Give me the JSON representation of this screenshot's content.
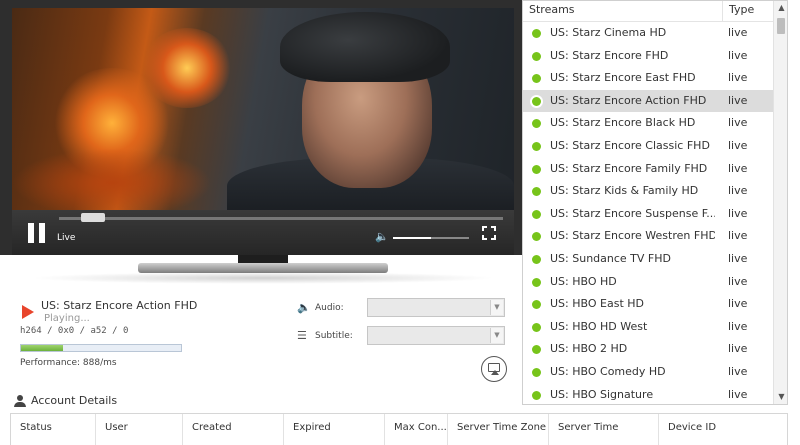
{
  "player": {
    "live_label": "Live",
    "seek_progress": 0.05,
    "volume_level": 0.5
  },
  "now_playing": {
    "title": "US: Starz Encore Action FHD",
    "status": "Playing...",
    "codec": "h264 / 0x0 / a52  / 0",
    "performance_label": "Performance:   888/ms",
    "performance_level": 0.26
  },
  "options": {
    "audio_label": "Audio:",
    "subtitle_label": "Subtitle:",
    "audio_value": "",
    "subtitle_value": ""
  },
  "streams": {
    "header_name": "Streams",
    "header_type": "Type",
    "items": [
      {
        "name": "US: Starz Cinema HD",
        "type": "live"
      },
      {
        "name": "US: Starz Encore FHD",
        "type": "live"
      },
      {
        "name": "US: Starz Encore East FHD",
        "type": "live"
      },
      {
        "name": "US: Starz Encore Action FHD",
        "type": "live"
      },
      {
        "name": "US: Starz Encore Black HD",
        "type": "live"
      },
      {
        "name": "US: Starz Encore Classic FHD",
        "type": "live"
      },
      {
        "name": "US: Starz Encore Family FHD",
        "type": "live"
      },
      {
        "name": "US: Starz Kids & Family HD",
        "type": "live"
      },
      {
        "name": "US: Starz Encore Suspense F...",
        "type": "live"
      },
      {
        "name": "US: Starz Encore Westren FHD",
        "type": "live"
      },
      {
        "name": "US: Sundance TV FHD",
        "type": "live"
      },
      {
        "name": "US: HBO HD",
        "type": "live"
      },
      {
        "name": "US: HBO East HD",
        "type": "live"
      },
      {
        "name": "US: HBO HD West",
        "type": "live"
      },
      {
        "name": "US: HBO 2 HD",
        "type": "live"
      },
      {
        "name": "US: HBO Comedy HD",
        "type": "live"
      },
      {
        "name": "US: HBO Signature",
        "type": "live"
      }
    ],
    "selected_index": 3,
    "status_color": "#77c41a"
  },
  "account": {
    "title": "Account Details",
    "columns": [
      "Status",
      "User",
      "Created",
      "Expired",
      "Max Con...",
      "Server Time Zone",
      "Server Time",
      "Device ID"
    ]
  }
}
